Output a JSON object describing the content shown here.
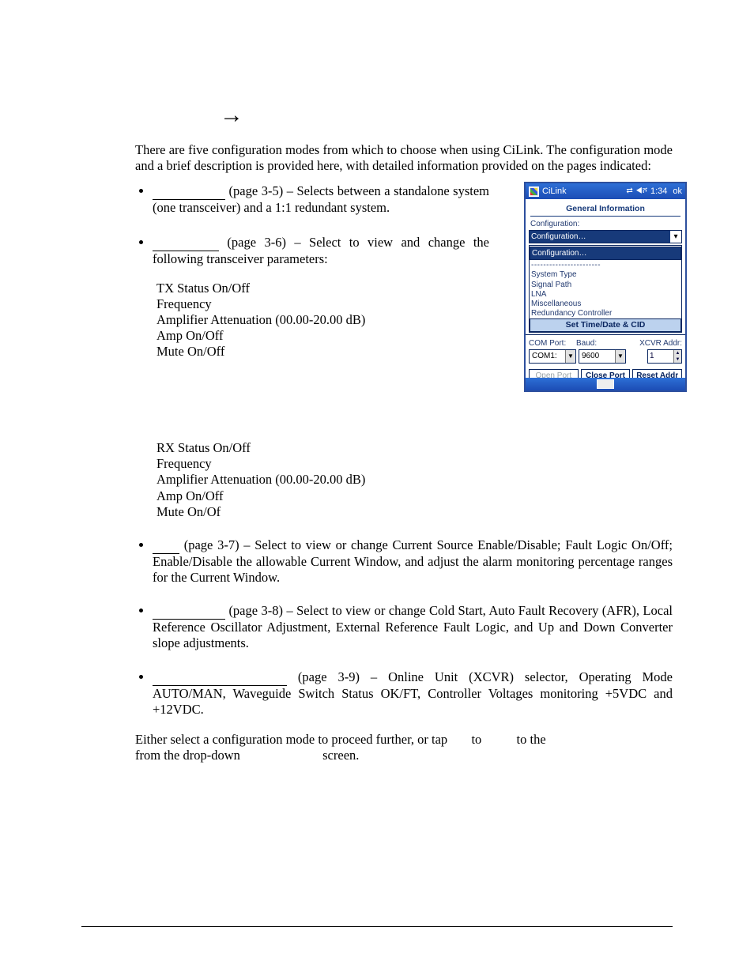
{
  "arrow": "→",
  "intro": "There are five configuration modes from which to choose when using CiLink. The configuration mode and a brief description is provided here, with detailed information provided on the pages indicated:",
  "b1": {
    "a": "(page 3-5) – Selects between a standalone system (one transceiver) and a 1:1 redundant system."
  },
  "b2": {
    "a": "(page 3-6) – Select to view and change the following transceiver parameters:",
    "tx": {
      "l1": "TX Status On/Off",
      "l2": "Frequency",
      "l3": "Amplifier Attenuation (00.00-20.00 dB)",
      "l4": "Amp On/Off",
      "l5": "Mute On/Off"
    },
    "rx": {
      "l1": "RX Status On/Off",
      "l2": "Frequency",
      "l3": "Amplifier Attenuation (00.00-20.00 dB)",
      "l4": "Amp On/Off",
      "l5": "Mute On/Of"
    }
  },
  "b3": "(page 3-7) – Select to view or change Current Source Enable/Disable; Fault Logic On/Off; Enable/Disable the allowable Current Window, and adjust the alarm monitoring percentage ranges for the Current Window.",
  "b4": "(page 3-8) – Select to view or change Cold Start, Auto Fault Recovery (AFR), Local Reference Oscillator Adjustment, External Reference Fault Logic, and Up and Down Converter slope adjustments.",
  "b5": "(page 3-9) – Online Unit (XCVR) selector, Operating Mode AUTO/MAN, Waveguide Switch Status OK/FT, Controller Voltages monitoring +5VDC and +12VDC.",
  "outro": {
    "p1": "Either select a configuration mode to proceed further, or tap",
    "p2": "to",
    "p3": "to the",
    "p4": "from the drop-down",
    "p5": "screen."
  },
  "pda": {
    "app": "CiLink",
    "time": "1:34",
    "ok": "ok",
    "header": "General Information",
    "cfg": "Configuration:",
    "sel": "Configuration…",
    "items": {
      "dash": "-----------------------",
      "i1": "System Type",
      "i2": "Signal Path",
      "i3": "LNA",
      "i4": "Miscellaneous",
      "i5": "Redundancy Controller",
      "hl": "Set Time/Date & CID"
    },
    "labels": {
      "com": "COM Port:",
      "baud": "Baud:",
      "addr": "XCVR Addr:"
    },
    "vals": {
      "com": "COM1:",
      "baud": "9600",
      "addr": "1"
    },
    "btns": {
      "open": "Open Port",
      "close": "Close Port",
      "reset": "Reset Addr"
    }
  }
}
